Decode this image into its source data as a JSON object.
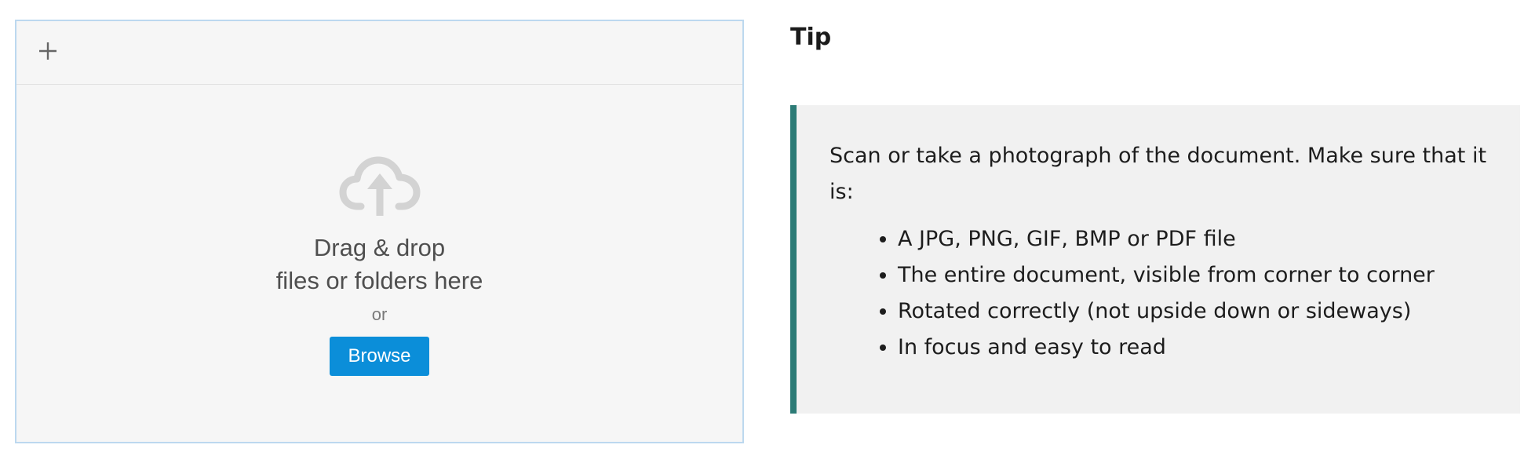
{
  "uploader": {
    "add_icon": "plus-icon",
    "upload_icon": "cloud-upload-icon",
    "drag_line1": "Drag & drop",
    "drag_line2": "files or folders here",
    "or_text": "or",
    "browse_label": "Browse",
    "colors": {
      "browse_button": "#0b8ed9",
      "border": "#bcd8ef",
      "background": "#f6f6f6"
    }
  },
  "tip": {
    "heading": "Tip",
    "intro": "Scan or take a photograph of the document. Make sure that it is:",
    "items": [
      "A JPG, PNG, GIF, BMP or PDF file",
      "The entire document, visible from corner to corner",
      "Rotated correctly (not upside down or sideways)",
      "In focus and easy to read"
    ],
    "colors": {
      "accent_border": "#2c7b76",
      "background": "#f1f1f1"
    }
  }
}
